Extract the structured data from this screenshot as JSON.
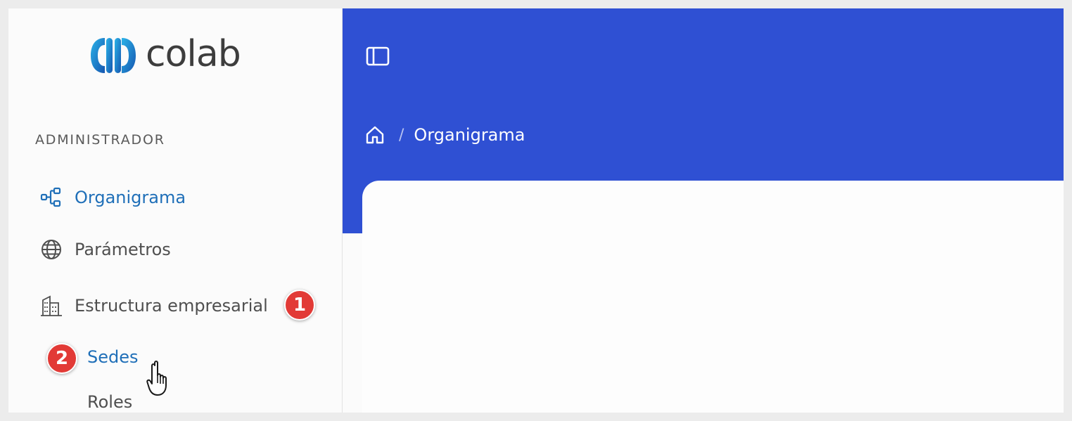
{
  "brand": {
    "name": "colab"
  },
  "sidebar": {
    "section_title": "ADMINISTRADOR",
    "items": [
      {
        "label": "Organigrama",
        "icon": "org-chart-icon",
        "active": true
      },
      {
        "label": "Parámetros",
        "icon": "globe-icon",
        "active": false
      },
      {
        "label": "Estructura empresarial",
        "icon": "building-icon",
        "active": false
      }
    ],
    "subitems": [
      {
        "label": "Sedes",
        "active": true
      },
      {
        "label": "Roles",
        "active": false
      }
    ]
  },
  "markers": [
    {
      "number": "1",
      "target": "Estructura empresarial"
    },
    {
      "number": "2",
      "target": "Sedes"
    }
  ],
  "header": {
    "breadcrumb": {
      "separator": "/",
      "current": "Organigrama"
    }
  },
  "colors": {
    "header_blue": "#2f50d3",
    "active_link": "#1f6fb8",
    "marker_red": "#e23a36"
  }
}
